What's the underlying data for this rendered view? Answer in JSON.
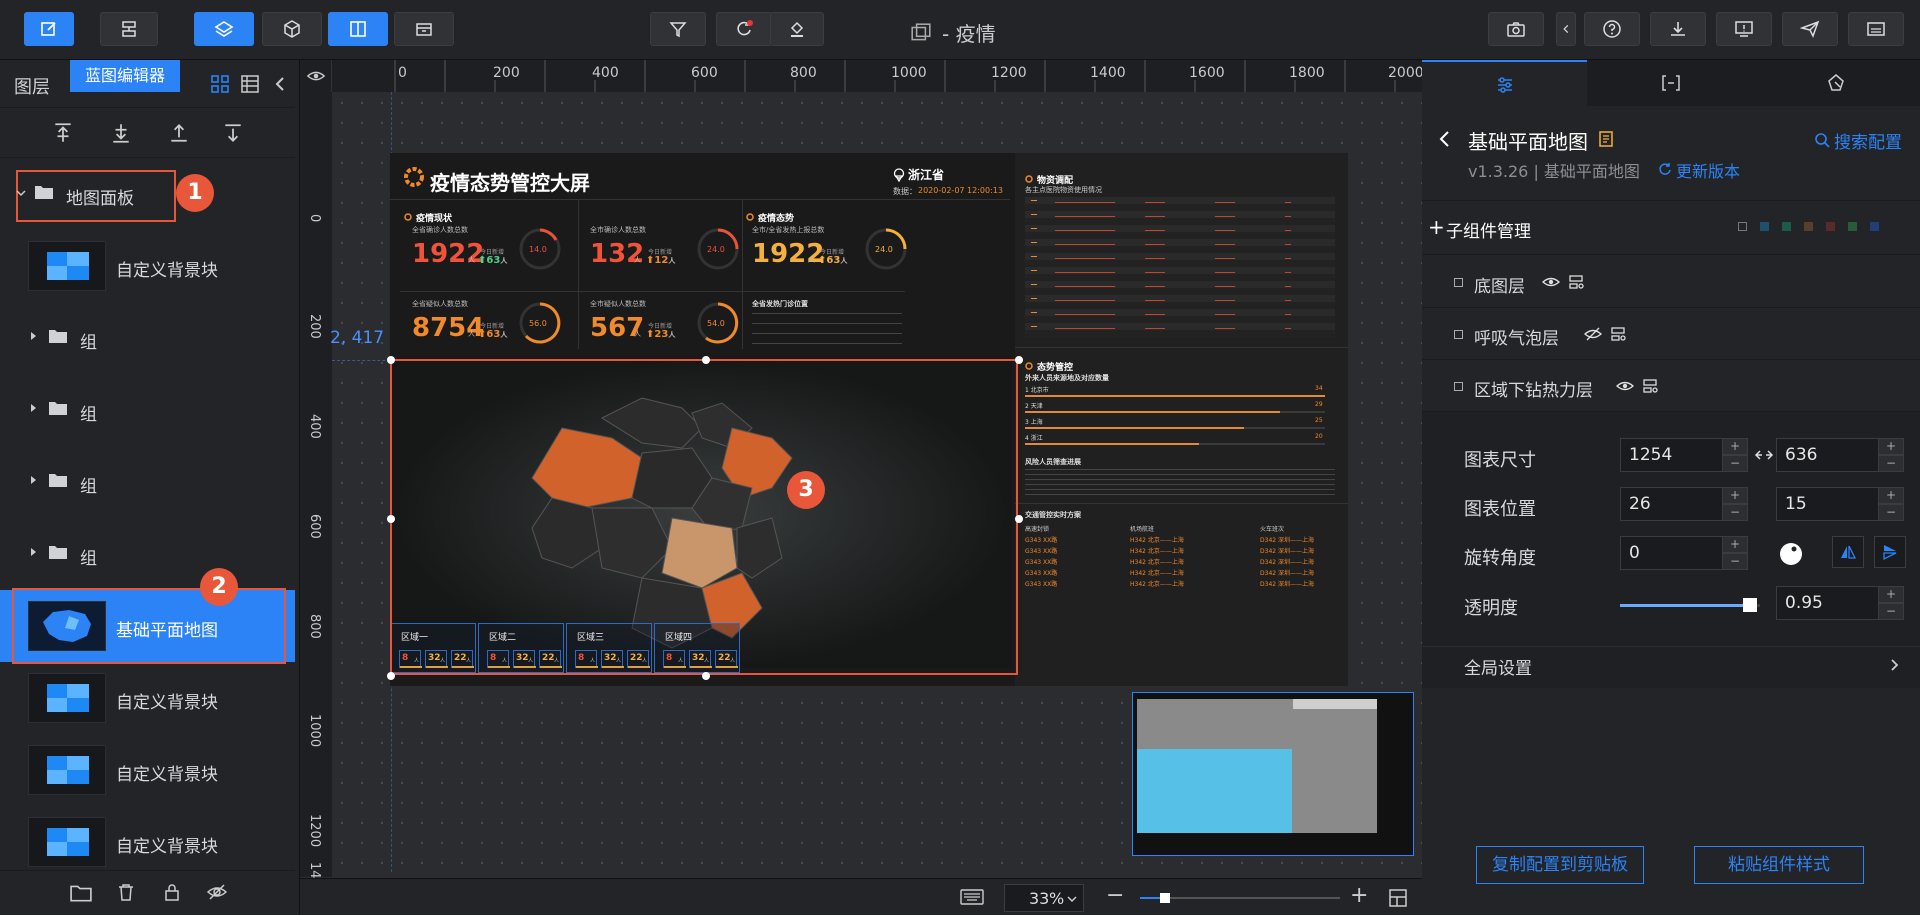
{
  "toolbar": {
    "title": "- 疫情",
    "tooltip": "蓝图编辑器"
  },
  "left": {
    "panel_title": "图层",
    "items": [
      {
        "label": "地图面板",
        "badge": "1"
      },
      {
        "label": "自定义背景块"
      },
      {
        "label": "组"
      },
      {
        "label": "组"
      },
      {
        "label": "组"
      },
      {
        "label": "组"
      },
      {
        "label": "基础平面地图",
        "badge": "2"
      },
      {
        "label": "自定义背景块"
      },
      {
        "label": "自定义背景块"
      },
      {
        "label": "自定义背景块"
      }
    ]
  },
  "ruler": {
    "h": [
      "0",
      "200",
      "400",
      "600",
      "800",
      "1000",
      "1200",
      "1400",
      "1600",
      "1800",
      "2000"
    ],
    "v": [
      "0",
      "200",
      "400",
      "600",
      "800",
      "1000",
      "1200",
      "14"
    ],
    "coord": "2, 417"
  },
  "canvas": {
    "zoom": "33",
    "zoom_unit": "%",
    "badge3": "3",
    "zoom_slider": 0.1
  },
  "dashboard": {
    "title": "疫情态势管控大屏",
    "province": "浙江省",
    "data_label": "数据：",
    "data_time": "2020-02-07 12:00:13",
    "section_status": "疫情现状",
    "section_trend": "疫情态势",
    "stats": [
      {
        "label": "全省确诊人数总数",
        "value": "1922",
        "unit": "人",
        "inc": "63",
        "inc_unit": "人",
        "sub": "今日新增",
        "ring": "14.0"
      },
      {
        "label": "全市确诊人数总数",
        "value": "132",
        "unit": "人",
        "inc": "12",
        "inc_unit": "人",
        "sub": "今日新增",
        "ring": "24.0"
      },
      {
        "label": "全市/全省发热上报总数",
        "value": "1922",
        "unit": "人",
        "inc": "63",
        "inc_unit": "人",
        "sub": "今日新增",
        "ring": "24.0"
      },
      {
        "label": "全省疑似人数总数",
        "value": "8754",
        "unit": "人",
        "inc": "63",
        "inc_unit": "人",
        "sub": "今日新增",
        "ring": "56.0"
      },
      {
        "label": "全市疑似人数总数",
        "value": "567",
        "unit": "人",
        "inc": "23",
        "inc_unit": "人",
        "sub": "今日新增",
        "ring": "54.0"
      }
    ],
    "hotspot_title": "全省发热门诊位置",
    "material_title": "物资调配",
    "material_sub": "各主点医院物资使用情况",
    "trend_title": "态势管控",
    "trend_sub": "外来人员来源地及对应数量",
    "trend_rows": [
      {
        "label": "1  北京市",
        "value": "34",
        "frac": 1
      },
      {
        "label": "2  天津",
        "value": "29",
        "frac": 0.85
      },
      {
        "label": "3  上海",
        "value": "25",
        "frac": 0.73
      },
      {
        "label": "4  浙江",
        "value": "20",
        "frac": 0.58
      }
    ],
    "risk_title": "风险人员筛查进展",
    "traffic_title": "交通管控实时方案",
    "traffic_cols": [
      "高速封锁",
      "机场航班",
      "火车班次"
    ],
    "traffic_cells": [
      "G343 XX路",
      "H342 北京——上海",
      "D342 深圳——上海"
    ],
    "regions": [
      "区域一",
      "区域二",
      "区域三",
      "区域四"
    ],
    "region_vals": [
      "8",
      "32",
      "22"
    ],
    "region_unit": "人"
  },
  "right": {
    "title": "基础平面地图",
    "version": "v1.3.26 | 基础平面地图",
    "update": "更新版本",
    "search": "搜索配置",
    "sub_manage": "子组件管理",
    "sublayers": [
      "底图层",
      "呼吸气泡层",
      "区域下钻热力层"
    ],
    "size_label": "图表尺寸",
    "size_w": "1254",
    "size_h": "636",
    "pos_label": "图表位置",
    "pos_x": "26",
    "pos_y": "15",
    "rot_label": "旋转角度",
    "rot": "0",
    "opacity_label": "透明度",
    "opacity": "0.95",
    "global_label": "全局设置",
    "copy_btn": "复制配置到剪贴板",
    "paste_btn": "粘贴组件样式"
  },
  "colors": {
    "accent": "#2b83f6",
    "danger": "#e8573a",
    "orange": "#e87b2e",
    "yellow": "#f5b13d"
  }
}
